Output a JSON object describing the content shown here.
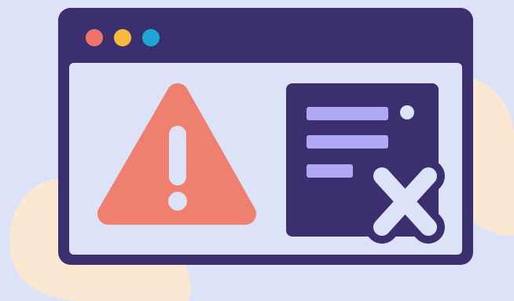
{
  "colors": {
    "background": "#DCE3F8",
    "blob": "#FBE8D3",
    "window_frame": "#3C2F70",
    "window_content": "#DCE3F8",
    "dot_red": "#F07368",
    "dot_yellow": "#F6BA3C",
    "dot_blue": "#1FA6D9",
    "warning_triangle": "#EF7F6E",
    "warning_mark": "#DCE3F8",
    "doc_panel": "#3C2F70",
    "doc_lines": "#AFA9F3",
    "doc_dot": "#DCE3F8",
    "close_x_fill": "#DCE3F8",
    "close_x_outline": "#3C2F70"
  },
  "icons": {
    "window": "browser-window-icon",
    "warning": "warning-triangle-icon",
    "document": "document-lines-icon",
    "error": "close-x-icon"
  }
}
